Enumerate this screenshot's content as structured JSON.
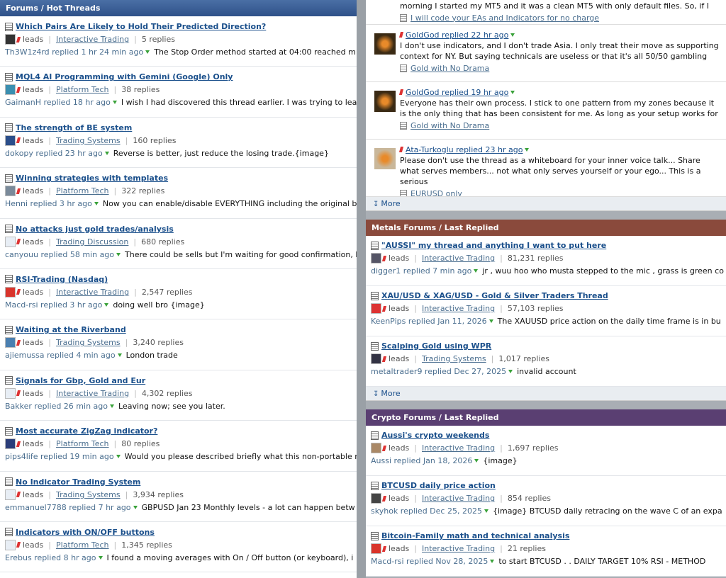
{
  "left": {
    "header": "Forums / Hot Threads",
    "threads": [
      {
        "title": "Which Pairs Are Likely to Hold Their Predicted Direction?",
        "leads": "leads",
        "forum": "Interactive Trading",
        "replies": "5 replies",
        "by": "Th3W1z4rd replied 1 hr 24 min ago",
        "snippet": "The Stop Order method started at 04:00 reached m",
        "avatar": "#333"
      },
      {
        "title": "MQL4 AI Programming with Gemini (Google) Only",
        "leads": "leads",
        "forum": "Platform Tech",
        "replies": "38 replies",
        "by": "GaimanH replied 18 hr ago",
        "snippet": "I wish I had discovered this thread earlier. I was trying to lea",
        "avatar": "#3a8fb0"
      },
      {
        "title": "The strength of BE system",
        "leads": "leads",
        "forum": "Trading Systems",
        "replies": "160 replies",
        "by": "dokopy replied 23 hr ago",
        "snippet": "Reverse is better, just reduce the losing trade.{image}",
        "avatar": "#2b4e8a"
      },
      {
        "title": "Winning strategies with templates",
        "leads": "leads",
        "forum": "Platform Tech",
        "replies": "322 replies",
        "by": "Henni replied 3 hr ago",
        "snippet": "Now you can enable/disable EVERYTHING including the original b",
        "avatar": "#7a8a9a"
      },
      {
        "title": "No attacks just gold trades/analysis",
        "leads": "leads",
        "forum": "Trading Discussion",
        "replies": "680 replies",
        "by": "canyouu replied 58 min ago",
        "snippet": "There could be sells but I'm waiting for good confirmation, b",
        "avatar": "#e8eef5"
      },
      {
        "title": "RSI-Trading (Nasdaq)",
        "leads": "leads",
        "forum": "Interactive Trading",
        "replies": "2,547 replies",
        "by": "Macd-rsi replied 3 hr ago",
        "snippet": "doing well bro {image}",
        "avatar": "#d9342b"
      },
      {
        "title": "Waiting at the Riverband",
        "leads": "leads",
        "forum": "Trading Systems",
        "replies": "3,240 replies",
        "by": "ajiemussa replied 4 min ago",
        "snippet": "London trade",
        "avatar": "#4a7fb0"
      },
      {
        "title": "Signals for Gbp, Gold and Eur",
        "leads": "leads",
        "forum": "Interactive Trading",
        "replies": "4,302 replies",
        "by": "Bakker replied 26 min ago",
        "snippet": "Leaving now; see you later.",
        "avatar": "#e8eef5"
      },
      {
        "title": "Most accurate ZigZag indicator?",
        "leads": "leads",
        "forum": "Platform Tech",
        "replies": "80 replies",
        "by": "pips4life replied 19 min ago",
        "snippet": "Would you please described briefly what this non-portable m",
        "avatar": "#2b3e7a"
      },
      {
        "title": "No Indicator Trading System",
        "leads": "leads",
        "forum": "Trading Systems",
        "replies": "3,934 replies",
        "by": "emmanuel7788 replied 7 hr ago",
        "snippet": "GBPUSD Jan 23 Monthly levels - a lot can happen betw",
        "avatar": "#e8eef5"
      },
      {
        "title": "Indicators with ON/OFF buttons",
        "leads": "leads",
        "forum": "Platform Tech",
        "replies": "1,345 replies",
        "by": "Erebus replied 8 hr ago",
        "snippet": "I found a moving averages with On / Off button (or keyboard), i",
        "avatar": "#e8eef5"
      }
    ]
  },
  "right": {
    "top_posts": [
      {
        "name": "",
        "text": "morning I started my MT5 and it was a clean MT5 with only default files. So, if I",
        "forum": "I will code your EAs and Indicators for no charge"
      },
      {
        "name": "GoldGod replied 22 hr ago",
        "text": "I don't use indicators, and I don't trade Asia. I only treat their move as supporting context for NY. But saying technicals are useless or that it's all 50/50 gambling",
        "forum": "Gold with No Drama"
      },
      {
        "name": "GoldGod replied 19 hr ago",
        "text": "Everyone has their own process. I stick to one pattern from my zones because it is the only thing that has been consistent for me. As long as your setup works for",
        "forum": "Gold with No Drama"
      },
      {
        "name": "Ata-Turkoglu replied 23 hr ago",
        "text": "Please don't use the thread as a whiteboard for your inner voice talk... Share what serves members... not what only serves yourself or your ego... This is a serious",
        "forum": "EURUSD only"
      }
    ],
    "more1": "More",
    "metals": {
      "header": "Metals Forums / Last Replied",
      "threads": [
        {
          "title": "\"AUSSI\" my thread and anything I want to put here",
          "leads": "leads",
          "forum": "Interactive Trading",
          "replies": "81,231 replies",
          "by": "digger1 replied 7 min ago",
          "snippet": "jr , wuu hoo who musta stepped to the mic , grass is green co",
          "avatar": "#556"
        },
        {
          "title": "XAU/USD & XAG/USD - Gold & Silver Traders Thread",
          "leads": "leads",
          "forum": "Interactive Trading",
          "replies": "57,103 replies",
          "by": "KeenPips replied Jan 11, 2026",
          "snippet": "The XAUUSD price action on the daily time frame is in bu",
          "avatar": "#d33"
        },
        {
          "title": "Scalping Gold using WPR",
          "leads": "leads",
          "forum": "Trading Systems",
          "replies": "1,017 replies",
          "by": "metaltrader9 replied Dec 27, 2025",
          "snippet": "invalid account",
          "avatar": "#334"
        }
      ],
      "more": "More"
    },
    "crypto": {
      "header": "Crypto Forums / Last Replied",
      "threads": [
        {
          "title": "Aussi's crypto weekends",
          "leads": "leads",
          "forum": "Interactive Trading",
          "replies": "1,697 replies",
          "by": "Aussi replied Jan 18, 2026",
          "snippet": "{image}",
          "avatar": "#a86"
        },
        {
          "title": "BTCUSD daily price action",
          "leads": "leads",
          "forum": "Interactive Trading",
          "replies": "854 replies",
          "by": "skyhok replied Dec 25, 2025",
          "snippet": "{image} BTCUSD daily retracing on the wave C of an expa",
          "avatar": "#444"
        },
        {
          "title": "Bitcoin-Family math and technical analysis",
          "leads": "leads",
          "forum": "Interactive Trading",
          "replies": "21 replies",
          "by": "Macd-rsi replied Nov 28, 2025",
          "snippet": "to start BTCUSD . . DAILY TARGET 10% RSI - METHOD",
          "avatar": "#d9342b"
        }
      ]
    }
  }
}
